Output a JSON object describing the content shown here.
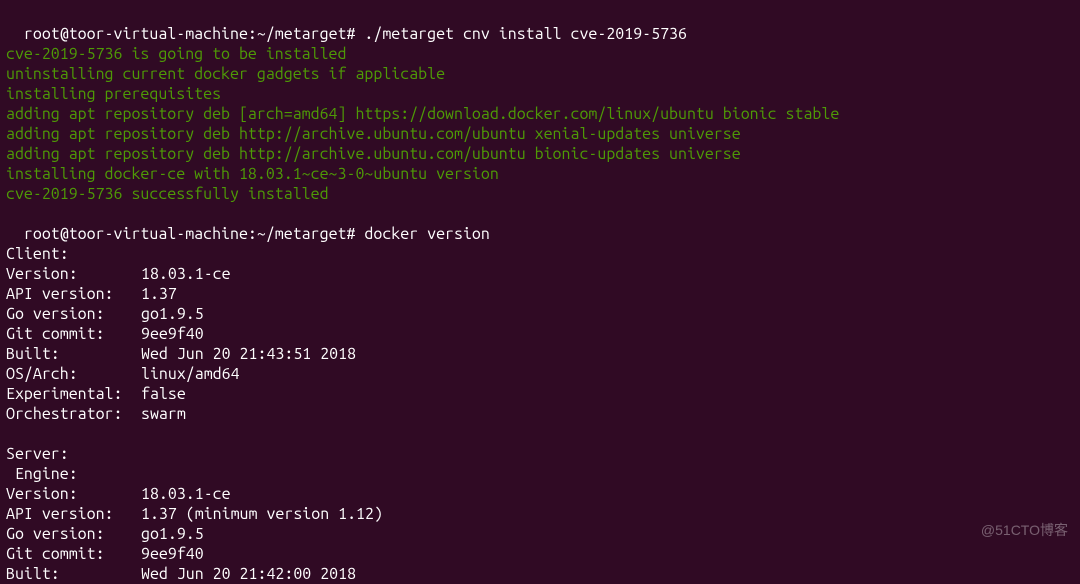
{
  "prompt1": {
    "prefix": "root@toor-virtual-machine:~/metarget# ",
    "command": "./metarget cnv install cve-2019-5736"
  },
  "output_green": [
    "cve-2019-5736 is going to be installed",
    "uninstalling current docker gadgets if applicable",
    "installing prerequisites",
    "adding apt repository deb [arch=amd64] https://download.docker.com/linux/ubuntu bionic stable",
    "adding apt repository deb http://archive.ubuntu.com/ubuntu xenial-updates universe",
    "adding apt repository deb http://archive.ubuntu.com/ubuntu bionic-updates universe",
    "installing docker-ce with 18.03.1~ce~3-0~ubuntu version",
    "cve-2019-5736 successfully installed"
  ],
  "prompt2": {
    "prefix": "root@toor-virtual-machine:~/metarget# ",
    "command": "docker version"
  },
  "client": {
    "header": "Client:",
    "rows": [
      {
        "label": " Version:",
        "value": "18.03.1-ce"
      },
      {
        "label": " API version:",
        "value": "1.37"
      },
      {
        "label": " Go version:",
        "value": "go1.9.5"
      },
      {
        "label": " Git commit:",
        "value": "9ee9f40"
      },
      {
        "label": " Built:",
        "value": "Wed Jun 20 21:43:51 2018"
      },
      {
        "label": " OS/Arch:",
        "value": "linux/amd64"
      },
      {
        "label": " Experimental:",
        "value": "false"
      },
      {
        "label": " Orchestrator:",
        "value": "swarm"
      }
    ]
  },
  "blank": " ",
  "server": {
    "header": "Server:",
    "engine": " Engine:",
    "rows": [
      {
        "label": "  Version:",
        "value": "18.03.1-ce"
      },
      {
        "label": "  API version:",
        "value": "1.37 (minimum version 1.12)"
      },
      {
        "label": "  Go version:",
        "value": "go1.9.5"
      },
      {
        "label": "  Git commit:",
        "value": "9ee9f40"
      },
      {
        "label": "  Built:",
        "value": "Wed Jun 20 21:42:00 2018"
      }
    ]
  },
  "watermark": "@51CTO博客"
}
